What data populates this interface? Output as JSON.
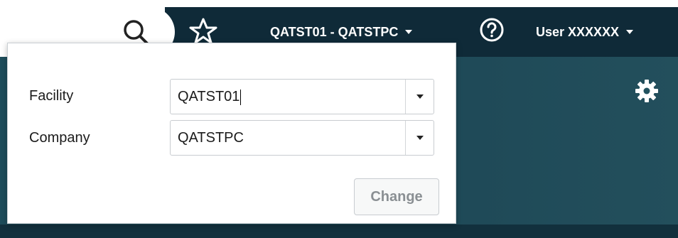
{
  "header": {
    "context_label": "QATST01 - QATSTPC",
    "user_label": "User XXXXXX"
  },
  "icons": {
    "search": "search-icon",
    "favorite": "star-icon",
    "help": "help-icon",
    "settings": "gear-icon"
  },
  "context_popup": {
    "facility": {
      "label": "Facility",
      "value": "QATST01"
    },
    "company": {
      "label": "Company",
      "value": "QATSTPC"
    },
    "change_label": "Change"
  },
  "colors": {
    "header_bg": "#0f2a38",
    "panel_bg": "#22525f",
    "button_text_disabled": "#8a8f93"
  }
}
